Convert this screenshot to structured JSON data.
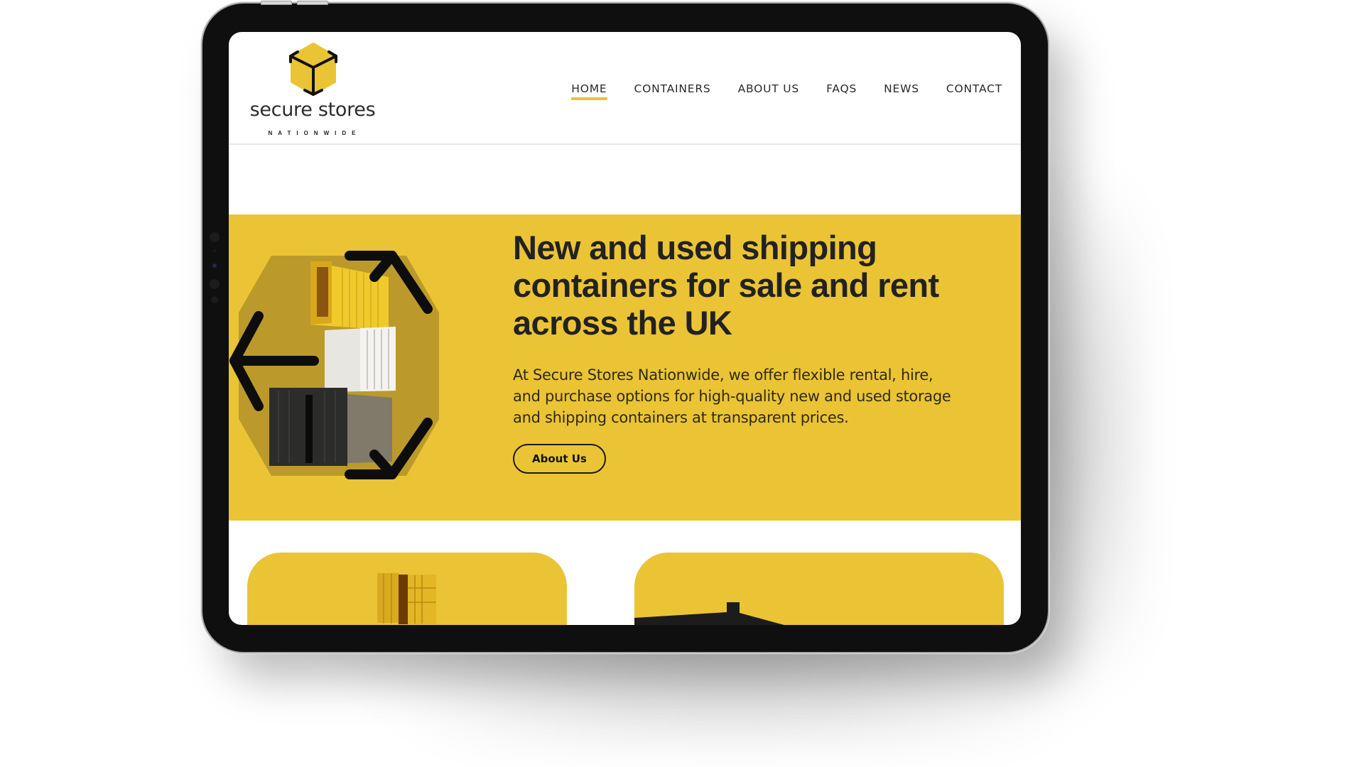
{
  "device": {
    "type": "tablet",
    "frame_color": "#0f0f0f"
  },
  "site": {
    "logo": {
      "name": "secure stores",
      "tagline": "NATIONWIDE",
      "icon": "cube-logo-icon"
    },
    "nav": {
      "items": [
        {
          "label": "HOME",
          "active": true
        },
        {
          "label": "CONTAINERS",
          "active": false
        },
        {
          "label": "ABOUT US",
          "active": false
        },
        {
          "label": "FAQS",
          "active": false
        },
        {
          "label": "NEWS",
          "active": false
        },
        {
          "label": "CONTACT",
          "active": false
        }
      ]
    },
    "hero": {
      "title": "New and used shipping containers for sale and rent across the UK",
      "description": "At Secure Stores Nationwide, we offer flexible rental, hire, and purchase options for high-quality new and used storage and shipping containers at transparent prices.",
      "button_label": "About Us",
      "image": "stacked-shipping-containers-with-recycle-arrows"
    },
    "cards": [
      {
        "image": "yellow-container-open-doors"
      },
      {
        "image": "black-container-silhouette"
      }
    ]
  },
  "colors": {
    "brand_yellow": "#ebc435",
    "text_dark": "#222222",
    "nav_underline": "#eac435"
  }
}
